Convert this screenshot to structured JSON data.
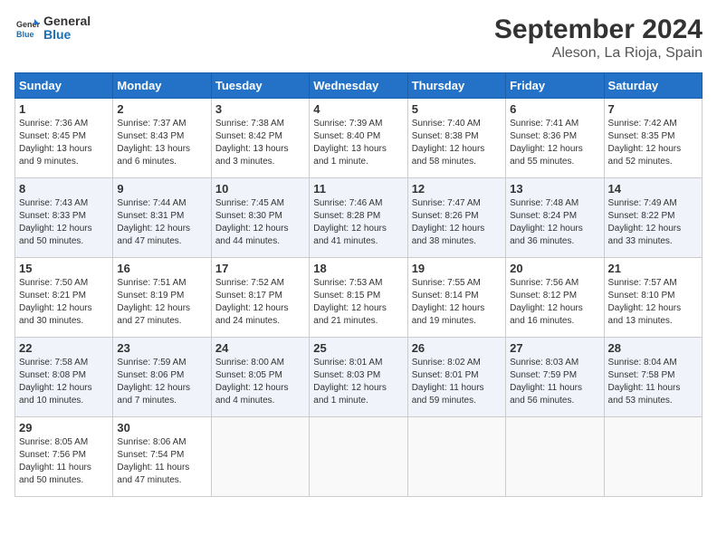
{
  "header": {
    "logo_line1": "General",
    "logo_line2": "Blue",
    "month": "September 2024",
    "location": "Aleson, La Rioja, Spain"
  },
  "columns": [
    "Sunday",
    "Monday",
    "Tuesday",
    "Wednesday",
    "Thursday",
    "Friday",
    "Saturday"
  ],
  "weeks": [
    [
      {
        "day": "1",
        "info": "Sunrise: 7:36 AM\nSunset: 8:45 PM\nDaylight: 13 hours\nand 9 minutes."
      },
      {
        "day": "2",
        "info": "Sunrise: 7:37 AM\nSunset: 8:43 PM\nDaylight: 13 hours\nand 6 minutes."
      },
      {
        "day": "3",
        "info": "Sunrise: 7:38 AM\nSunset: 8:42 PM\nDaylight: 13 hours\nand 3 minutes."
      },
      {
        "day": "4",
        "info": "Sunrise: 7:39 AM\nSunset: 8:40 PM\nDaylight: 13 hours\nand 1 minute."
      },
      {
        "day": "5",
        "info": "Sunrise: 7:40 AM\nSunset: 8:38 PM\nDaylight: 12 hours\nand 58 minutes."
      },
      {
        "day": "6",
        "info": "Sunrise: 7:41 AM\nSunset: 8:36 PM\nDaylight: 12 hours\nand 55 minutes."
      },
      {
        "day": "7",
        "info": "Sunrise: 7:42 AM\nSunset: 8:35 PM\nDaylight: 12 hours\nand 52 minutes."
      }
    ],
    [
      {
        "day": "8",
        "info": "Sunrise: 7:43 AM\nSunset: 8:33 PM\nDaylight: 12 hours\nand 50 minutes."
      },
      {
        "day": "9",
        "info": "Sunrise: 7:44 AM\nSunset: 8:31 PM\nDaylight: 12 hours\nand 47 minutes."
      },
      {
        "day": "10",
        "info": "Sunrise: 7:45 AM\nSunset: 8:30 PM\nDaylight: 12 hours\nand 44 minutes."
      },
      {
        "day": "11",
        "info": "Sunrise: 7:46 AM\nSunset: 8:28 PM\nDaylight: 12 hours\nand 41 minutes."
      },
      {
        "day": "12",
        "info": "Sunrise: 7:47 AM\nSunset: 8:26 PM\nDaylight: 12 hours\nand 38 minutes."
      },
      {
        "day": "13",
        "info": "Sunrise: 7:48 AM\nSunset: 8:24 PM\nDaylight: 12 hours\nand 36 minutes."
      },
      {
        "day": "14",
        "info": "Sunrise: 7:49 AM\nSunset: 8:22 PM\nDaylight: 12 hours\nand 33 minutes."
      }
    ],
    [
      {
        "day": "15",
        "info": "Sunrise: 7:50 AM\nSunset: 8:21 PM\nDaylight: 12 hours\nand 30 minutes."
      },
      {
        "day": "16",
        "info": "Sunrise: 7:51 AM\nSunset: 8:19 PM\nDaylight: 12 hours\nand 27 minutes."
      },
      {
        "day": "17",
        "info": "Sunrise: 7:52 AM\nSunset: 8:17 PM\nDaylight: 12 hours\nand 24 minutes."
      },
      {
        "day": "18",
        "info": "Sunrise: 7:53 AM\nSunset: 8:15 PM\nDaylight: 12 hours\nand 21 minutes."
      },
      {
        "day": "19",
        "info": "Sunrise: 7:55 AM\nSunset: 8:14 PM\nDaylight: 12 hours\nand 19 minutes."
      },
      {
        "day": "20",
        "info": "Sunrise: 7:56 AM\nSunset: 8:12 PM\nDaylight: 12 hours\nand 16 minutes."
      },
      {
        "day": "21",
        "info": "Sunrise: 7:57 AM\nSunset: 8:10 PM\nDaylight: 12 hours\nand 13 minutes."
      }
    ],
    [
      {
        "day": "22",
        "info": "Sunrise: 7:58 AM\nSunset: 8:08 PM\nDaylight: 12 hours\nand 10 minutes."
      },
      {
        "day": "23",
        "info": "Sunrise: 7:59 AM\nSunset: 8:06 PM\nDaylight: 12 hours\nand 7 minutes."
      },
      {
        "day": "24",
        "info": "Sunrise: 8:00 AM\nSunset: 8:05 PM\nDaylight: 12 hours\nand 4 minutes."
      },
      {
        "day": "25",
        "info": "Sunrise: 8:01 AM\nSunset: 8:03 PM\nDaylight: 12 hours\nand 1 minute."
      },
      {
        "day": "26",
        "info": "Sunrise: 8:02 AM\nSunset: 8:01 PM\nDaylight: 11 hours\nand 59 minutes."
      },
      {
        "day": "27",
        "info": "Sunrise: 8:03 AM\nSunset: 7:59 PM\nDaylight: 11 hours\nand 56 minutes."
      },
      {
        "day": "28",
        "info": "Sunrise: 8:04 AM\nSunset: 7:58 PM\nDaylight: 11 hours\nand 53 minutes."
      }
    ],
    [
      {
        "day": "29",
        "info": "Sunrise: 8:05 AM\nSunset: 7:56 PM\nDaylight: 11 hours\nand 50 minutes."
      },
      {
        "day": "30",
        "info": "Sunrise: 8:06 AM\nSunset: 7:54 PM\nDaylight: 11 hours\nand 47 minutes."
      },
      {
        "day": "",
        "info": ""
      },
      {
        "day": "",
        "info": ""
      },
      {
        "day": "",
        "info": ""
      },
      {
        "day": "",
        "info": ""
      },
      {
        "day": "",
        "info": ""
      }
    ]
  ]
}
